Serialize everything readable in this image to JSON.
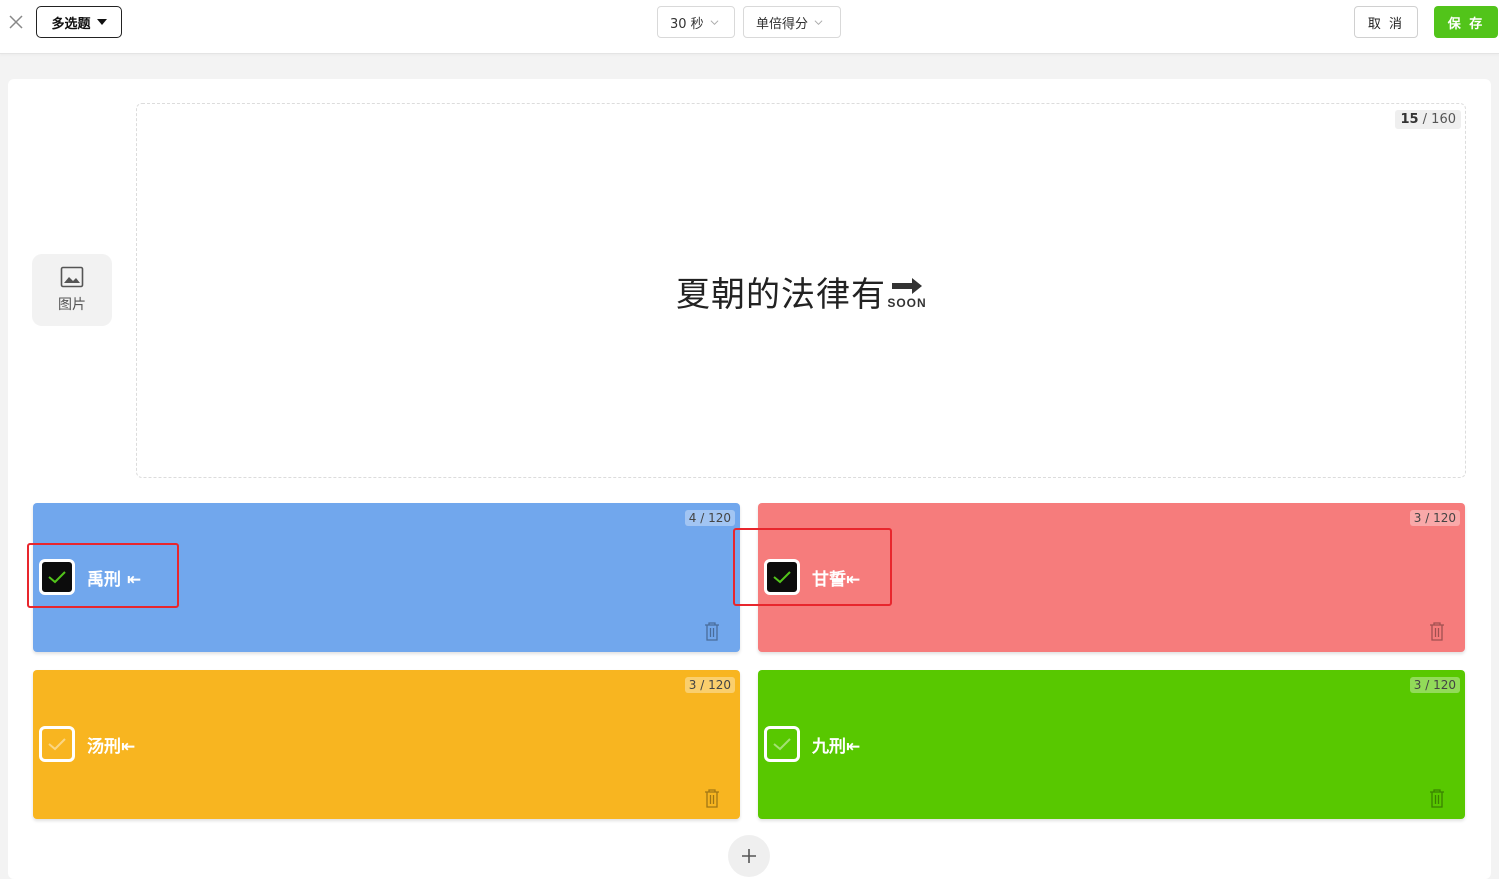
{
  "header": {
    "question_type": "多选题",
    "time_limit": "30 秒",
    "scoring": "单倍得分",
    "cancel_label": "取 消",
    "save_label": "保 存",
    "save_color": "#52c41a"
  },
  "sidebar": {
    "image_button_label": "图片"
  },
  "question": {
    "text": "夏朝的法律有",
    "char_count": "15",
    "char_limit": "/ 160",
    "trailing_icon_label": "SOON"
  },
  "options": [
    {
      "text": "禹刑 ⇤",
      "counter": "4 / 120",
      "checked": true,
      "color": "#71a7ed"
    },
    {
      "text": "甘誓⇤",
      "counter": "3 / 120",
      "checked": true,
      "color": "#f67c7c"
    },
    {
      "text": "汤刑⇤",
      "counter": "3 / 120",
      "checked": false,
      "color": "#f8b520"
    },
    {
      "text": "九刑⇤",
      "counter": "3 / 120",
      "checked": false,
      "color": "#58c800"
    }
  ],
  "icons": {
    "close": "close-icon",
    "image": "image-icon",
    "trash": "trash-icon",
    "add": "plus-icon",
    "check": "check-icon",
    "soon": "soon-arrow-icon"
  },
  "highlight_color": "#e8262d"
}
